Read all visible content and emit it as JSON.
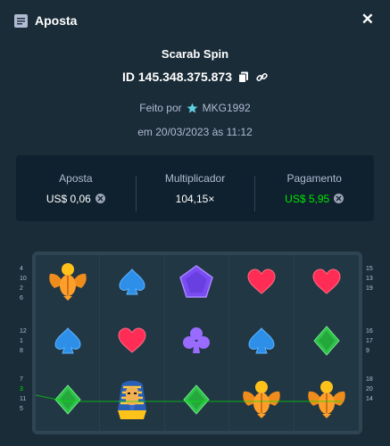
{
  "header": {
    "title": "Aposta",
    "icon": "receipt-icon",
    "close_icon": "close-icon"
  },
  "game": {
    "name": "Scarab Spin",
    "bet_id": "ID 145.348.375.873",
    "made_by_label": "Feito por",
    "author": "MKG1992",
    "date": "em 20/03/2023 às 11:12"
  },
  "stats": {
    "bet_label": "Aposta",
    "bet_value": "US$ 0,06",
    "multiplier_label": "Multiplicador",
    "multiplier_value": "104,15×",
    "payout_label": "Pagamento",
    "payout_value": "US$ 5,95"
  },
  "colors": {
    "background": "#1a2c38",
    "panel": "#0f212e",
    "green": "#00e701",
    "board": "#213743"
  },
  "board": {
    "rows": [
      [
        "scarab",
        "spade-blue",
        "pentagon-purple",
        "heart-red",
        "heart-red"
      ],
      [
        "spade-blue",
        "heart-red",
        "club-purple",
        "spade-blue",
        "diamond-green"
      ],
      [
        "diamond-green",
        "pharaoh",
        "diamond-green",
        "scarab",
        "scarab"
      ]
    ],
    "left_paylines": [
      [
        "4",
        "10",
        "2",
        "6"
      ],
      [
        "12",
        "1",
        "8"
      ],
      [
        "7",
        "3",
        "11",
        "5"
      ]
    ],
    "right_paylines": [
      [
        "15",
        "13",
        "19"
      ],
      [
        "16",
        "17",
        "9"
      ],
      [
        "18",
        "20",
        "14"
      ]
    ],
    "highlight_payline": "3"
  }
}
